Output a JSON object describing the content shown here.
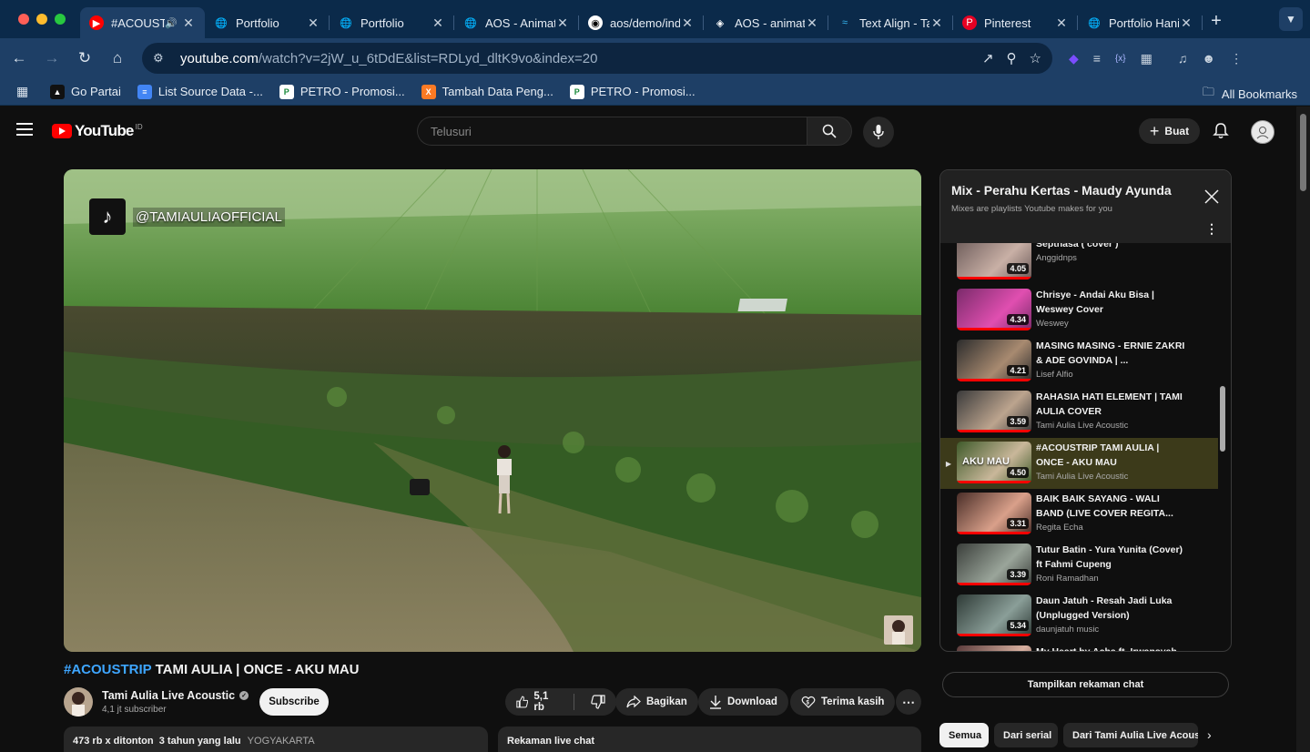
{
  "browser": {
    "tabs": [
      {
        "title": "#ACOUSTRIP TAMI AULIA",
        "favicon": "youtube-icon",
        "active": true
      },
      {
        "title": "Portfolio",
        "favicon": "globe-icon"
      },
      {
        "title": "Portfolio",
        "favicon": "globe-icon"
      },
      {
        "title": "AOS - Animate on scroll",
        "favicon": "globe-icon"
      },
      {
        "title": "aos/demo/index.html",
        "favicon": "github-icon"
      },
      {
        "title": "AOS - animate on scroll",
        "favicon": "codepen-icon"
      },
      {
        "title": "Text Align - Tailwind",
        "favicon": "tailwind-icon"
      },
      {
        "title": "Pinterest",
        "favicon": "pinterest-icon"
      },
      {
        "title": "Portfolio Hanif",
        "favicon": "globe-icon"
      }
    ],
    "url_host": "youtube.com",
    "url_path": "/watch?v=2jW_u_6tDdE&list=RDLyd_dltK9vo&index=20",
    "bookmarks": [
      {
        "label": "Go Partai",
        "favicon": "triangle-icon"
      },
      {
        "label": "List Source Data -...",
        "favicon": "docs-icon"
      },
      {
        "label": "PETRO - Promosi...",
        "favicon": "petro-icon"
      },
      {
        "label": "Tambah Data Peng...",
        "favicon": "xampp-icon"
      },
      {
        "label": "PETRO - Promosi...",
        "favicon": "petro-icon"
      }
    ],
    "all_bookmarks": "All Bookmarks"
  },
  "youtube": {
    "logo_text": "YouTube",
    "country_code": "ID",
    "search_placeholder": "Telusuri",
    "create_label": "Buat",
    "video": {
      "tiktok_handle": "@TAMIAULIAOFFICIAL",
      "title_tag": "#ACOUSTRIP",
      "title_rest": " TAMI AULIA | ONCE - AKU MAU",
      "channel_name": "Tami Aulia Live Acoustic",
      "subscribers": "4,1 jt subscriber",
      "subscribe_label": "Subscribe",
      "likes": "5,1 rb",
      "share_label": "Bagikan",
      "download_label": "Download",
      "thanks_label": "Terima kasih",
      "views": "473 rb x ditonton",
      "age": "3 tahun yang lalu",
      "location": "YOGYAKARTA",
      "live_chat_replay": "Rekaman live chat"
    },
    "playlist": {
      "title": "Mix - Perahu Kertas - Maudy Ayunda",
      "subtitle": "Mixes are playlists Youtube makes for you",
      "items": [
        {
          "title": "Septhasa ( cover )",
          "channel": "Anggidnps",
          "duration": "4.05",
          "thumb": [
            "#6b5a58",
            "#c9b0a6"
          ]
        },
        {
          "title": "Chrisye - Andai Aku Bisa | Weswey Cover",
          "channel": "Weswey",
          "duration": "4.34",
          "thumb": [
            "#7a2a6a",
            "#e04fb0"
          ]
        },
        {
          "title": "MASING MASING - ERNIE ZAKRI & ADE GOVINDA | ...",
          "channel": "Lisef Alfio",
          "duration": "4.21",
          "thumb": [
            "#2c2c2c",
            "#a88a70"
          ]
        },
        {
          "title": "RAHASIA HATI ELEMENT | TAMI AULIA COVER",
          "channel": "Tami Aulia Live Acoustic",
          "duration": "3.59",
          "thumb": [
            "#3a3a3a",
            "#bca48e"
          ]
        },
        {
          "title": "#ACOUSTRIP TAMI AULIA | ONCE - AKU MAU",
          "channel": "Tami Aulia Live Acoustic",
          "duration": "4.50",
          "thumb": [
            "#3f5a2a",
            "#c9b79a"
          ],
          "active": true,
          "overlay": "AKU MAU"
        },
        {
          "title": "BAIK BAIK SAYANG - WALI BAND (LIVE COVER REGITA...",
          "channel": "Regita Echa",
          "duration": "3.31",
          "thumb": [
            "#4a2e28",
            "#d9a08a"
          ]
        },
        {
          "title": "Tutur Batin - Yura Yunita (Cover) ft Fahmi Cupeng",
          "channel": "Roni Ramadhan",
          "duration": "3.39",
          "thumb": [
            "#3a3e3a",
            "#9aa59a"
          ]
        },
        {
          "title": "Daun Jatuh - Resah Jadi Luka (Unplugged Version)",
          "channel": "daunjatuh music",
          "duration": "5.34",
          "thumb": [
            "#2e3a36",
            "#8a9e98"
          ]
        },
        {
          "title": "My Heart by Acha ft. Irwansyah (Cover by Langit ft...",
          "channel": "",
          "duration": "",
          "thumb": [
            "#5a3a3a",
            "#d8b0a0"
          ]
        }
      ]
    },
    "show_chat_label": "Tampilkan rekaman chat",
    "chips": [
      "Semua",
      "Dari serial",
      "Dari Tami Aulia Live Acoustic"
    ]
  }
}
